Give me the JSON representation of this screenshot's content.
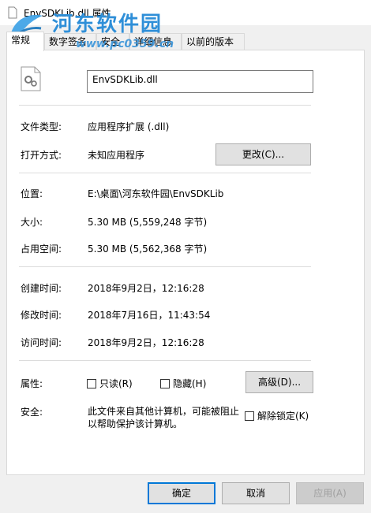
{
  "window": {
    "title": "EnvSDKLib.dll 属性"
  },
  "watermark": {
    "name": "河东软件园",
    "url": "www.pc0359.cn"
  },
  "tabs": [
    {
      "label": "常规",
      "active": true
    },
    {
      "label": "数字签名"
    },
    {
      "label": "安全"
    },
    {
      "label": "详细信息"
    },
    {
      "label": "以前的版本"
    }
  ],
  "general": {
    "filename": "EnvSDKLib.dll",
    "file_type_label": "文件类型:",
    "file_type_value": "应用程序扩展 (.dll)",
    "opens_with_label": "打开方式:",
    "opens_with_value": "未知应用程序",
    "change_button": "更改(C)...",
    "location_label": "位置:",
    "location_value": "E:\\桌面\\河东软件园\\EnvSDKLib",
    "size_label": "大小:",
    "size_value": "5.30 MB (5,559,248 字节)",
    "size_on_disk_label": "占用空间:",
    "size_on_disk_value": "5.30 MB (5,562,368 字节)",
    "created_label": "创建时间:",
    "created_value": "2018年9月2日，12:16:28",
    "modified_label": "修改时间:",
    "modified_value": "2018年7月16日，11:43:54",
    "accessed_label": "访问时间:",
    "accessed_value": "2018年9月2日，12:16:28",
    "attributes_label": "属性:",
    "readonly_label": "只读(R)",
    "hidden_label": "隐藏(H)",
    "advanced_button": "高级(D)...",
    "security_label": "安全:",
    "security_text": "此文件来自其他计算机，可能被阻止以帮助保护该计算机。",
    "unblock_label": "解除锁定(K)"
  },
  "footer": {
    "ok": "确定",
    "cancel": "取消",
    "apply": "应用(A)"
  }
}
